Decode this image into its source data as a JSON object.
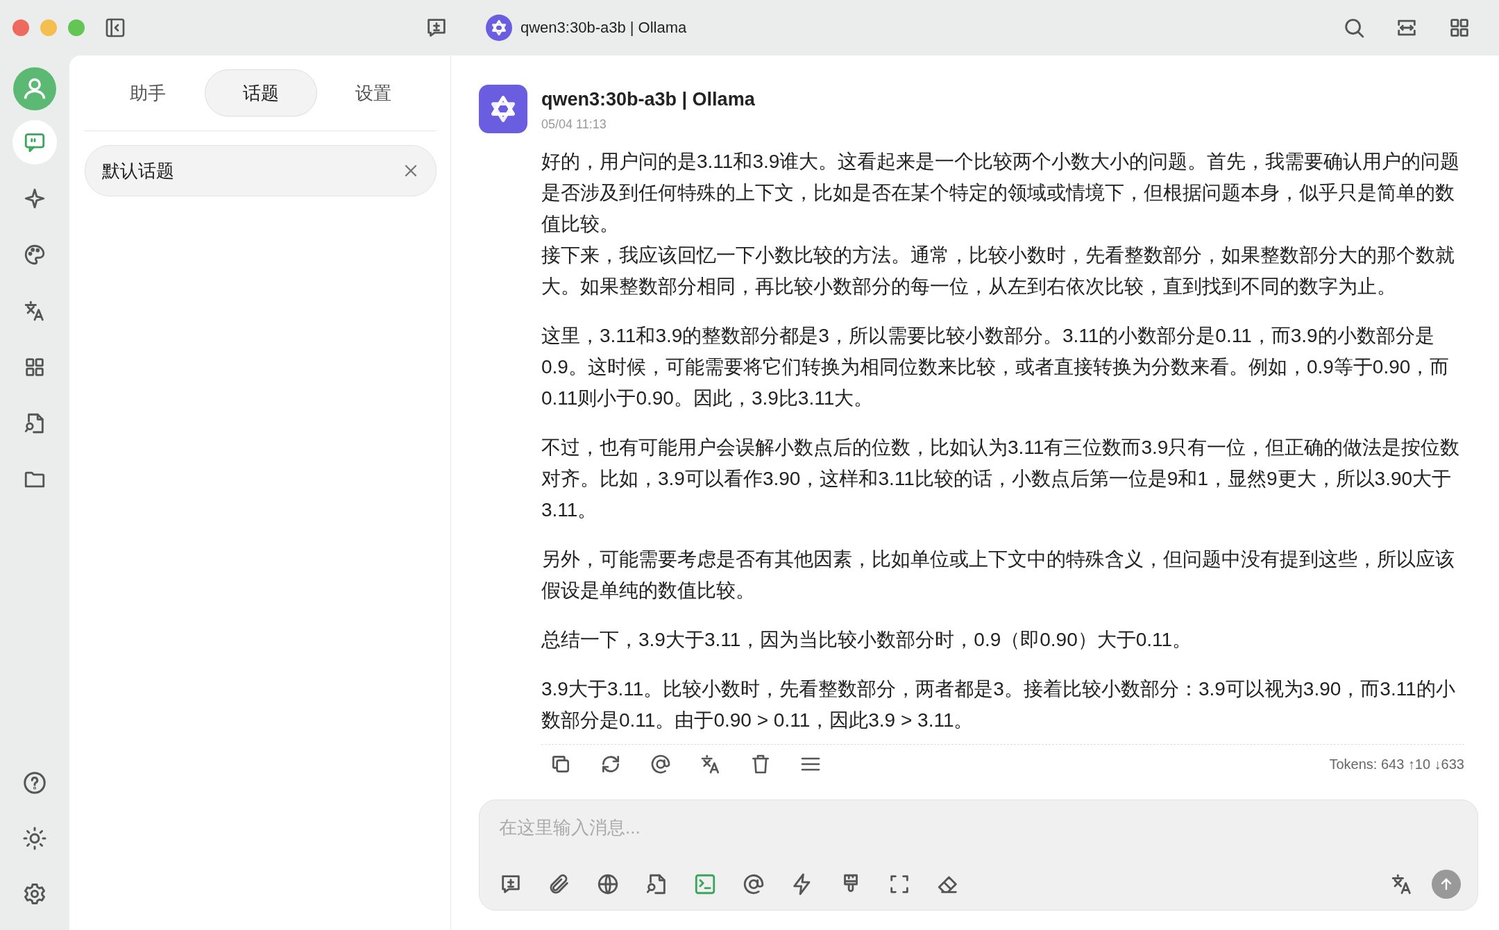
{
  "window": {
    "title": "qwen3:30b-a3b | Ollama"
  },
  "rail": {
    "items": [
      {
        "selected": true
      },
      {
        "selected": false
      },
      {
        "selected": false
      },
      {
        "selected": false
      },
      {
        "selected": false
      },
      {
        "selected": false
      },
      {
        "selected": false
      }
    ]
  },
  "sidebar": {
    "tabs": [
      {
        "label": "助手",
        "selected": false
      },
      {
        "label": "话题",
        "selected": true
      },
      {
        "label": "设置",
        "selected": false
      }
    ],
    "topics": [
      {
        "title": "默认话题",
        "selected": true
      }
    ]
  },
  "message": {
    "sender": "qwen3:30b-a3b | Ollama",
    "time": "05/04 11:13",
    "paragraphs": [
      {
        "lines": [
          "好的，用户问的是3.11和3.9谁大。这看起来是一个比较两个小数大小的问题。首先，我需要确认用户的问题是否涉及到任何特殊的上下文，比如是否在某个特定的领域或情境下，但根据问题本身，似乎只是简单的数值比较。",
          "接下来，我应该回忆一下小数比较的方法。通常，比较小数时，先看整数部分，如果整数部分大的那个数就大。如果整数部分相同，再比较小数部分的每一位，从左到右依次比较，直到找到不同的数字为止。"
        ]
      },
      {
        "lines": [
          "这里，3.11和3.9的整数部分都是3，所以需要比较小数部分。3.11的小数部分是0.11，而3.9的小数部分是0.9。这时候，可能需要将它们转换为相同位数来比较，或者直接转换为分数来看。例如，0.9等于0.90，而0.11则小于0.90。因此，3.9比3.11大。"
        ]
      },
      {
        "lines": [
          "不过，也有可能用户会误解小数点后的位数，比如认为3.11有三位数而3.9只有一位，但正确的做法是按位数对齐。比如，3.9可以看作3.90，这样和3.11比较的话，小数点后第一位是9和1，显然9更大，所以3.90大于3.11。"
        ]
      },
      {
        "lines": [
          "另外，可能需要考虑是否有其他因素，比如单位或上下文中的特殊含义，但问题中没有提到这些，所以应该假设是单纯的数值比较。"
        ]
      },
      {
        "lines": [
          "总结一下，3.9大于3.11，因为当比较小数部分时，0.9（即0.90）大于0.11。"
        ]
      },
      {
        "lines": [
          "3.9大于3.11。比较小数时，先看整数部分，两者都是3。接着比较小数部分：3.9可以视为3.90，而3.11的小数部分是0.11。由于0.90 > 0.11，因此3.9 > 3.11。"
        ]
      }
    ],
    "tokens": "Tokens: 643 ↑10 ↓633"
  },
  "input": {
    "placeholder": "在这里输入消息...",
    "tools": [
      {
        "on": false
      },
      {
        "on": false
      },
      {
        "on": false
      },
      {
        "on": false
      },
      {
        "on": true
      },
      {
        "on": false
      },
      {
        "on": false
      },
      {
        "on": false
      },
      {
        "on": false
      },
      {
        "on": false
      }
    ]
  }
}
